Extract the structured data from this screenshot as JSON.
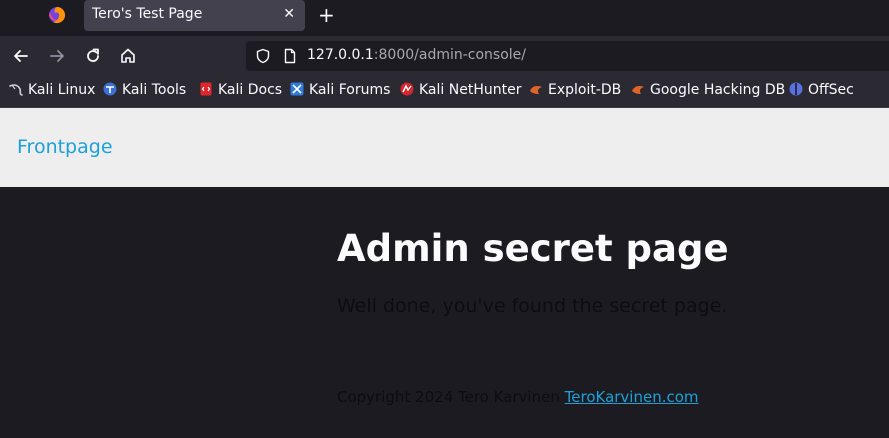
{
  "browser": {
    "tab": {
      "title": "Tero's Test Page",
      "close_glyph": "✕"
    },
    "new_tab_glyph": "+",
    "url": {
      "host": "127.0.0.1",
      "rest": ":8000/admin-console/"
    },
    "icons": {
      "back": "back-arrow-icon",
      "forward": "forward-arrow-icon",
      "reload": "reload-icon",
      "home": "home-icon",
      "shield": "tracking-shield-icon",
      "page": "page-info-icon"
    }
  },
  "bookmarks": [
    {
      "label": "Kali Linux",
      "icon": "kali-dragon-icon",
      "color": "#d0d0d0"
    },
    {
      "label": "Kali Tools",
      "icon": "kali-tools-icon",
      "color": "#3b6fd6"
    },
    {
      "label": "Kali Docs",
      "icon": "kali-docs-icon",
      "color": "#e0242c"
    },
    {
      "label": "Kali Forums",
      "icon": "kali-forums-icon",
      "color": "#2f7bd8"
    },
    {
      "label": "Kali NetHunter",
      "icon": "nethunter-icon",
      "color": "#d5262f"
    },
    {
      "label": "Exploit-DB",
      "icon": "exploit-db-icon",
      "color": "#e0642a"
    },
    {
      "label": "Google Hacking DB",
      "icon": "ghdb-icon",
      "color": "#e0642a"
    },
    {
      "label": "OffSec",
      "icon": "offsec-icon",
      "color": "#5a6fe0"
    }
  ],
  "page": {
    "nav_link": "Frontpage",
    "heading": "Admin secret page",
    "paragraph": "Well done, you've found the secret page.",
    "footer_text": "Copyright 2024 Tero Karvinen",
    "footer_link": "TeroKarvinen.com"
  },
  "colors": {
    "link": "#1ba1d8",
    "page_bg": "#1c1b22",
    "nav_bg": "#eeeeee"
  }
}
